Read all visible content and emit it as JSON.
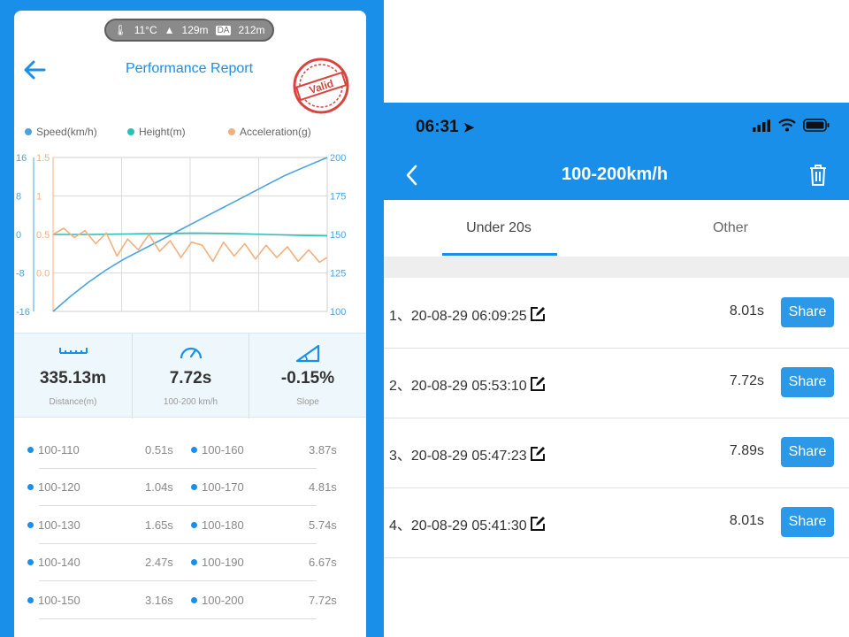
{
  "left_phone": {
    "env": {
      "temperature": "11°C",
      "altitude": "129m",
      "da_badge": "DA",
      "density_altitude": "212m"
    },
    "title": "Performance Report",
    "stamp_text": "Valid",
    "legend": [
      {
        "label": "Speed(km/h)",
        "color": "#4aa3e0"
      },
      {
        "label": "Height(m)",
        "color": "#2bbfb8"
      },
      {
        "label": "Acceleration(g)",
        "color": "#f3b07d"
      }
    ],
    "axes": {
      "left_height_ticks": [
        "16",
        "8",
        "0",
        "-8",
        "-16"
      ],
      "left_accel_ticks": [
        "1.5",
        "1",
        "0.5",
        "0.0"
      ],
      "right_speed_ticks": [
        "200",
        "175",
        "150",
        "125",
        "100"
      ]
    },
    "stats": [
      {
        "icon": "ruler-icon",
        "value": "335.13m",
        "label": "Distance(m)"
      },
      {
        "icon": "speedometer-icon",
        "value": "7.72s",
        "label": "100-200 km/h"
      },
      {
        "icon": "slope-icon",
        "value": "-0.15%",
        "label": "Slope"
      }
    ],
    "splits_left": [
      {
        "range": "100-110",
        "time": "0.51s"
      },
      {
        "range": "100-120",
        "time": "1.04s"
      },
      {
        "range": "100-130",
        "time": "1.65s"
      },
      {
        "range": "100-140",
        "time": "2.47s"
      },
      {
        "range": "100-150",
        "time": "3.16s"
      }
    ],
    "splits_right": [
      {
        "range": "100-160",
        "time": "3.87s"
      },
      {
        "range": "100-170",
        "time": "4.81s"
      },
      {
        "range": "100-180",
        "time": "5.74s"
      },
      {
        "range": "100-190",
        "time": "6.67s"
      },
      {
        "range": "100-200",
        "time": "7.72s"
      }
    ]
  },
  "chart_data": {
    "type": "line",
    "title": "",
    "x_ticks": [],
    "series": [
      {
        "name": "Speed(km/h)",
        "axis": "right",
        "color": "#4aa3e0",
        "t": [
          0,
          0.5,
          1,
          1.5,
          2,
          2.5,
          3,
          3.5,
          4,
          4.5,
          5,
          5.5,
          6,
          6.5,
          7,
          7.72
        ],
        "values": [
          100,
          110,
          119,
          127,
          134,
          140,
          146,
          152,
          158,
          164,
          170,
          176,
          182,
          188,
          193,
          200
        ]
      },
      {
        "name": "Height(m)",
        "axis": "left_height",
        "color": "#2bbfb8",
        "t": [
          0,
          1,
          2,
          3,
          4,
          5,
          6,
          7,
          7.72
        ],
        "values": [
          0,
          0,
          0.1,
          0.2,
          0.3,
          0.2,
          0,
          -0.2,
          -0.3
        ]
      },
      {
        "name": "Acceleration(g)",
        "axis": "left_accel",
        "color": "#f3b07d",
        "t": [
          0,
          0.3,
          0.6,
          0.9,
          1.2,
          1.5,
          1.8,
          2.1,
          2.4,
          2.7,
          3.0,
          3.3,
          3.6,
          3.9,
          4.2,
          4.5,
          4.8,
          5.1,
          5.4,
          5.7,
          6.0,
          6.3,
          6.6,
          6.9,
          7.2,
          7.5,
          7.72
        ],
        "values": [
          0.5,
          0.58,
          0.46,
          0.55,
          0.38,
          0.52,
          0.22,
          0.44,
          0.3,
          0.5,
          0.28,
          0.42,
          0.2,
          0.4,
          0.36,
          0.15,
          0.4,
          0.22,
          0.38,
          0.18,
          0.36,
          0.2,
          0.34,
          0.15,
          0.3,
          0.14,
          0.2
        ]
      }
    ],
    "y_axes": {
      "left_height": {
        "range": [
          -16,
          16
        ],
        "ticks": [
          16,
          8,
          0,
          -8,
          -16
        ]
      },
      "left_accel": {
        "range": [
          -0.5,
          1.5
        ],
        "ticks": [
          1.5,
          1,
          0.5,
          0.0
        ]
      },
      "right": {
        "range": [
          100,
          200
        ],
        "ticks": [
          200,
          175,
          150,
          125,
          100
        ]
      }
    },
    "grid": true,
    "legend_position": "top"
  },
  "right_phone": {
    "status_time": "06:31",
    "title": "100-200km/h",
    "tabs": [
      {
        "label": "Under 20s",
        "active": true
      },
      {
        "label": "Other",
        "active": false
      }
    ],
    "records": [
      {
        "label": "1、20-08-29 06:09:25",
        "time": "8.01s",
        "share": "Share"
      },
      {
        "label": "2、20-08-29 05:53:10",
        "time": "7.72s",
        "share": "Share"
      },
      {
        "label": "3、20-08-29 05:47:23",
        "time": "7.89s",
        "share": "Share"
      },
      {
        "label": "4、20-08-29 05:41:30",
        "time": "8.01s",
        "share": "Share"
      }
    ],
    "colors": {
      "accent": "#1a8fea",
      "share_button": "#2c99e8"
    }
  }
}
